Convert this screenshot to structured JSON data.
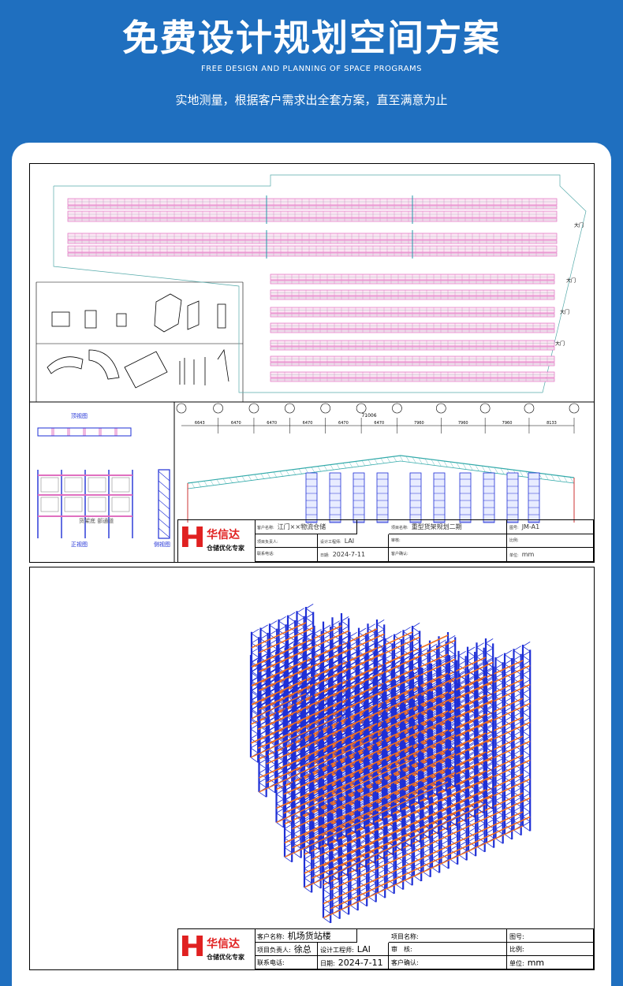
{
  "header": {
    "title": "免费设计规划空间方案",
    "subtitle_en": "FREE DESIGN AND PLANNING OF SPACE PROGRAMS",
    "subtitle_cn": "实地测量，根据客户需求出全套方案，直至满意为止"
  },
  "drawing1": {
    "section_labels": {
      "top_view": "顶视图",
      "front_view": "正视图",
      "side_view": "侧视图",
      "aisle": "货架底\n部通道"
    },
    "dimensions": {
      "total": "71006",
      "bays": [
        "6643",
        "6470",
        "6470",
        "6470",
        "6470",
        "6470",
        "7960",
        "7960",
        "7960",
        "8133"
      ]
    },
    "door_labels": [
      "大门",
      "大门",
      "大门",
      "大门"
    ],
    "title_block": {
      "logo_name": "华信达",
      "logo_slogan": "仓储优化专家",
      "client_label": "客户名称:",
      "client_value": "江门××物流仓储",
      "project_label": "项目名称:",
      "project_value": "重型货架规划二期",
      "drawing_no_label": "图号:",
      "drawing_no_value": "JM-A1",
      "manager_label": "项目负责人:",
      "engineer_label": "设计工程师:",
      "engineer_value": "LAI",
      "review_label": "审核:",
      "scale_label": "比例:",
      "contact_label": "联系电话:",
      "date_label": "日期:",
      "date_value": "2024-7-11",
      "confirm_label": "客户确认:",
      "unit_label": "单位:",
      "unit_value": "mm"
    }
  },
  "drawing2": {
    "title_block": {
      "logo_name": "华信达",
      "logo_slogan": "仓储优化专家",
      "client_label": "客户名称:",
      "client_value": "机场货站楼",
      "project_label": "项目名称:",
      "drawing_no_label": "图号:",
      "manager_label": "项目负责人:",
      "manager_value": "徐总",
      "engineer_label": "设计工程师:",
      "engineer_value": "LAI",
      "review_label": "审　核:",
      "scale_label": "比例:",
      "contact_label": "联系电话:",
      "date_label": "日期:",
      "date_value": "2024-7-11",
      "confirm_label": "客户确认:",
      "unit_label": "单位:",
      "unit_value": "mm"
    }
  },
  "colors": {
    "background": "#1f6fbf",
    "upright_blue": "#1e2fd6",
    "beam_orange": "#f07020",
    "rack_pink": "#e070c0",
    "logo_red": "#e02020"
  }
}
